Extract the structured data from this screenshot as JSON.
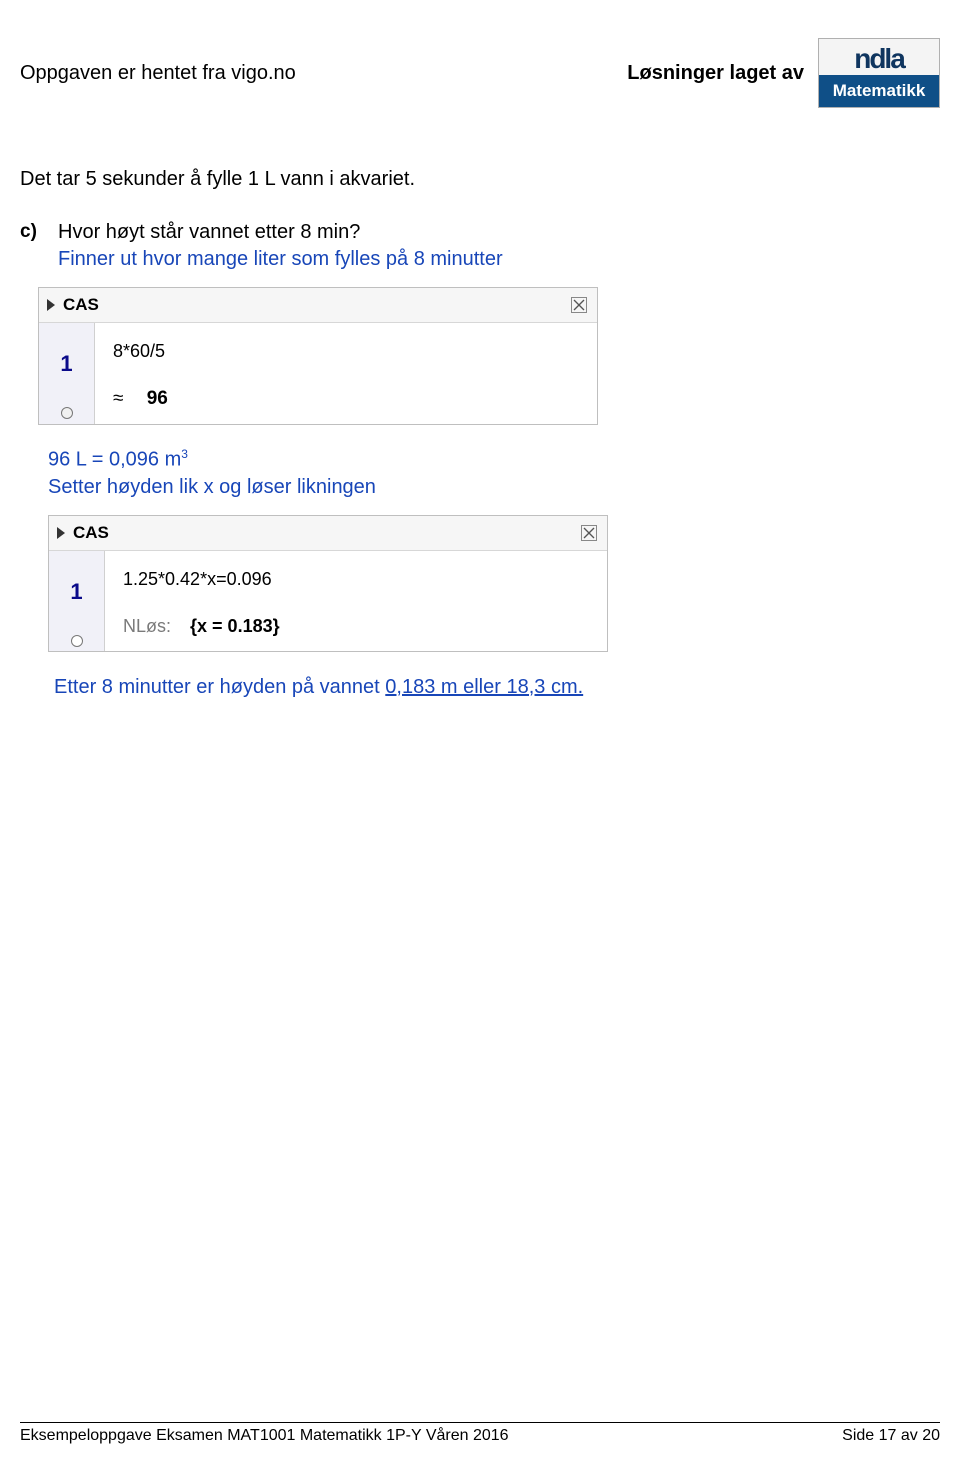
{
  "header": {
    "left": "Oppgaven er hentet fra vigo.no",
    "right_text": "Løsninger laget av",
    "logo_top": "ndla",
    "logo_bottom": "Matematikk"
  },
  "body": {
    "intro": "Det tar 5 sekunder å fylle 1 L vann i akvariet.",
    "part_label": "c)",
    "question": "Hvor høyt står vannet etter 8 min?",
    "solution1": "Finner ut hvor mange liter som fylles på 8 minutter",
    "cas1": {
      "title": "CAS",
      "row": "1",
      "input": "8*60/5",
      "approx_symbol": "≈",
      "result": "96"
    },
    "eq_L": "96 L",
    "eq_eq": " = ",
    "eq_R1": "0,096 m",
    "eq_R2": "3",
    "solution2": "Setter høyden lik x og løser likningen",
    "cas2": {
      "title": "CAS",
      "row": "1",
      "input": "1.25*0.42*x=0.096",
      "nlos_label": "NLøs:",
      "nlos_result": "{x = 0.183}"
    },
    "final_pre": "Etter 8 minutter er høyden på vannet ",
    "final_ud": "0,183 m eller 18,3 cm."
  },
  "footer": {
    "left": "Eksempeloppgave Eksamen MAT1001 Matematikk 1P-Y Våren 2016",
    "right": "Side 17 av 20"
  }
}
